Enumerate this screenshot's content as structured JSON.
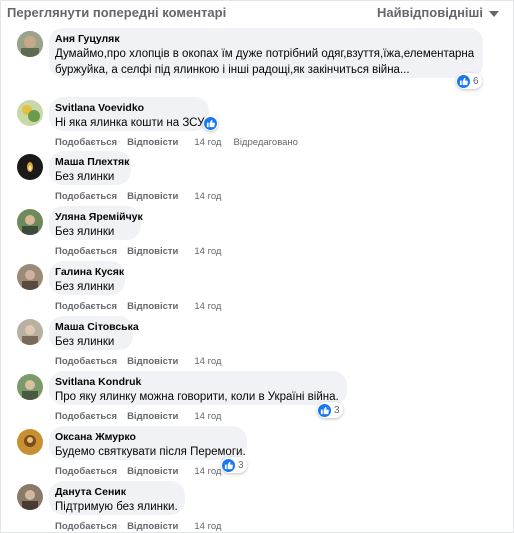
{
  "header": {
    "prev_comments": "Переглянути попередні коментарі",
    "sort_label": "Найвідповідніші"
  },
  "actions": {
    "like": "Подобається",
    "reply": "Відповісти"
  },
  "comments": [
    {
      "author": "Аня Гуцуляк",
      "text_lines": [
        "Думаймо,про хлопців в окопах їм дуже потрібний одяг,взуття,їжа,елементарна",
        "буржуйка, а селфі під ялинкою і інші радощі,як закінчиться війна..."
      ],
      "time": "",
      "reactions": "6"
    },
    {
      "author": "Svitlana Voevidko",
      "text_lines": [
        "Ні яка ялинка кошти на ЗСУ."
      ],
      "time": "14 год",
      "edited": "Відредаговано",
      "reactions": ""
    },
    {
      "author": "Маша Плехтяк",
      "text_lines": [
        "Без ялинки"
      ],
      "time": "14 год"
    },
    {
      "author": "Уляна Яремійчук",
      "text_lines": [
        "Без ялинки"
      ],
      "time": "14 год"
    },
    {
      "author": "Галина Кусяк",
      "text_lines": [
        "Без ялинки"
      ],
      "time": "14 год"
    },
    {
      "author": "Маша Сітовська",
      "text_lines": [
        "Без ялинки"
      ],
      "time": "14 год"
    },
    {
      "author": "Svitlana Kondruk",
      "text_lines": [
        "Про яку ялинку можна говорити, коли в Україні війна."
      ],
      "time": "14 год",
      "reactions": "3"
    },
    {
      "author": "Оксана Жмурко",
      "text_lines": [
        "Будемо святкувати після Перемоги."
      ],
      "time": "14 год",
      "reactions": "3"
    },
    {
      "author": "Данута Сеник",
      "text_lines": [
        "Підтримую без ялинки."
      ],
      "time": "14 год"
    }
  ],
  "colors": {
    "like_blue": "#1877f2",
    "bubble": "#f0f2f5",
    "muted": "#65676b"
  },
  "icons": {
    "sort_caret": "chevron-down-icon",
    "like": "like-icon"
  }
}
